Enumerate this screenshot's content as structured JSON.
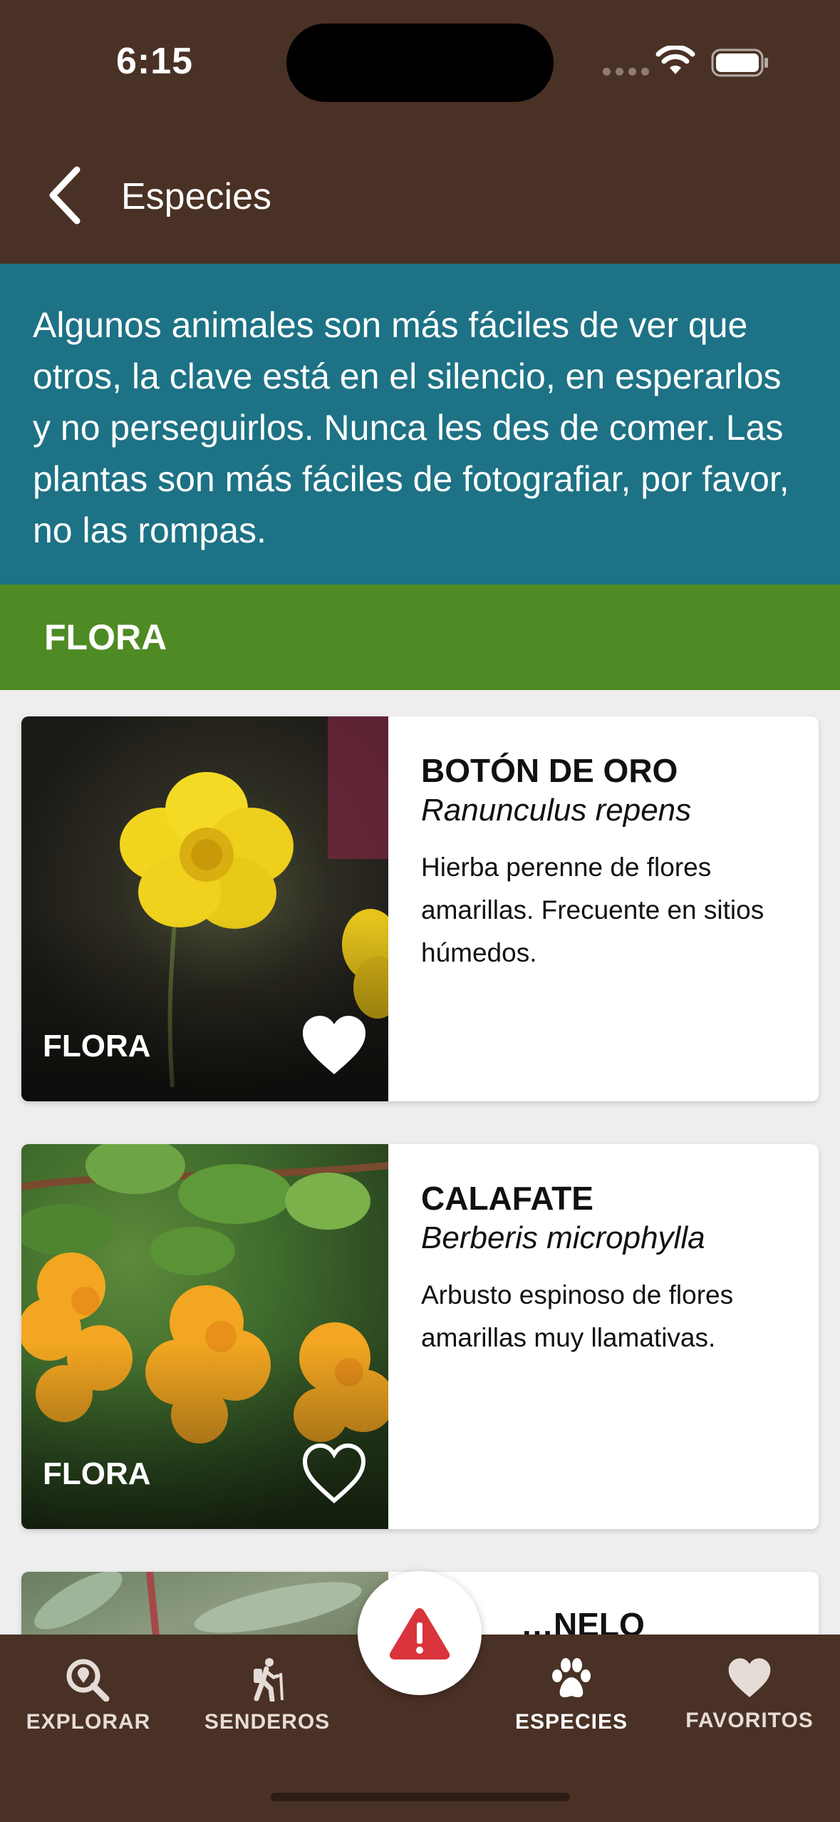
{
  "status_bar": {
    "time": "6:15"
  },
  "nav": {
    "title": "Especies"
  },
  "intro": {
    "text": "Algunos animales son más fáciles de ver que otros, la clave está en el silencio, en esperarlos y no perseguirlos. Nunca les des de comer. Las plantas son más fáciles de fotografiar, por favor, no las rompas."
  },
  "section": {
    "title": "FLORA"
  },
  "species": [
    {
      "name": "BOTÓN DE ORO",
      "scientific": "Ranunculus repens",
      "description": "Hierba perenne de flores amarillas. Frecuente en sitios húmedos.",
      "tag": "FLORA",
      "favorite": true
    },
    {
      "name": "CALAFATE",
      "scientific": "Berberis microphylla",
      "description": "Arbusto espinoso de flores amarillas muy llamativas.",
      "tag": "FLORA",
      "favorite": false
    },
    {
      "name": "…NELO",
      "scientific": "",
      "description": "",
      "tag": "",
      "favorite": false
    }
  ],
  "tabbar": {
    "items": [
      {
        "label": "EXPLORAR",
        "icon": "search-location-icon",
        "active": false
      },
      {
        "label": "SENDEROS",
        "icon": "hiker-icon",
        "active": false
      },
      {
        "label": "ESPECIES",
        "icon": "paw-icon",
        "active": true
      },
      {
        "label": "FAVORITOS",
        "icon": "heart-icon",
        "active": false
      }
    ],
    "center_icon": "warning-icon"
  },
  "colors": {
    "header_bg": "#4a3125",
    "intro_bg": "#1d7285",
    "section_bg": "#4e8b24",
    "alert_red": "#d9343b"
  }
}
